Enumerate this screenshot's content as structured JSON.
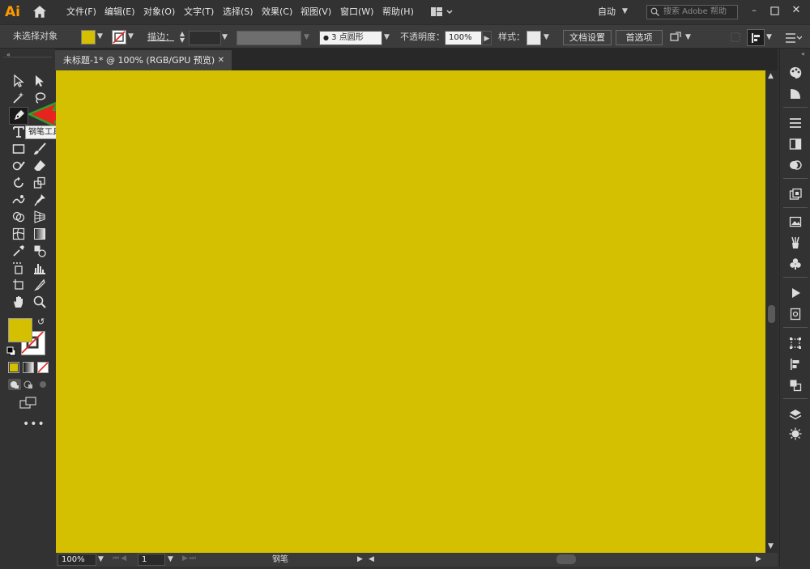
{
  "app": {
    "logo": "Ai"
  },
  "menu": [
    "文件(F)",
    "编辑(E)",
    "对象(O)",
    "文字(T)",
    "选择(S)",
    "效果(C)",
    "视图(V)",
    "窗口(W)",
    "帮助(H)"
  ],
  "workspace": {
    "label": "自动"
  },
  "search": {
    "placeholder": "搜索 Adobe 帮助"
  },
  "control_bar": {
    "selection_status": "未选择对象",
    "fill_color": "#d4c000",
    "stroke_label": "描边：",
    "brush_value": "3 点圆形",
    "opacity_label": "不透明度：",
    "opacity_value": "100%",
    "style_label": "样式：",
    "doc_setup": "文档设置",
    "preferences": "首选项"
  },
  "document": {
    "tab_title": "未标题-1* @ 100% (RGB/GPU 预览)",
    "close_glyph": "✕",
    "canvas_color": "#d4c000"
  },
  "tooltip": {
    "text": "钢笔工具 (P)"
  },
  "status_bar": {
    "zoom": "100%",
    "artboard": "1",
    "tool_name": "钢笔"
  },
  "colors": {
    "accent_arrow": "#e8231e",
    "arrow_outline": "#2ea12e"
  }
}
